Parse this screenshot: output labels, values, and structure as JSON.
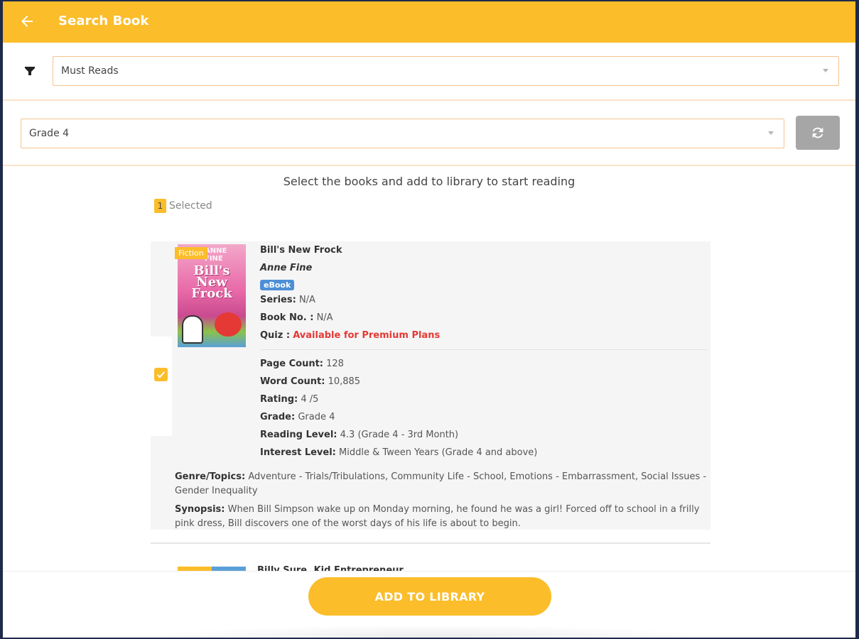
{
  "colors": {
    "accent": "#fbbd2a",
    "border": "#f7c38d",
    "premium": "#e53935",
    "ebook_badge": "#4d8fd6",
    "refresh_button": "#a6a6a6"
  },
  "header": {
    "title": "Search Book",
    "back_icon": "arrow-left-icon"
  },
  "filters": {
    "filter_icon": "funnel-icon",
    "category_value": "Must Reads",
    "grade_value": "Grade 4",
    "refresh_icon": "refresh-icon"
  },
  "instruction": "Select the books and add to library to start reading",
  "selection": {
    "count": "1",
    "label": "Selected"
  },
  "books": [
    {
      "title": "Bill's New Frock",
      "author": "Anne Fine",
      "tag": "Fiction",
      "format": "eBook",
      "checked": true,
      "series_label": "Series:",
      "series": "N/A",
      "book_no_label": "Book No. :",
      "book_no": "N/A",
      "quiz_label": "Quiz :",
      "quiz": "Available for Premium Plans",
      "page_count_label": "Page Count:",
      "page_count": "128",
      "word_count_label": "Word Count:",
      "word_count": "10,885",
      "rating_label": "Rating:",
      "rating": "4 /5",
      "grade_label": "Grade:",
      "grade": "Grade 4",
      "reading_level_label": "Reading Level:",
      "reading_level": "4.3 (Grade 4 - 3rd Month)",
      "interest_level_label": "Interest Level:",
      "interest_level": "Middle & Tween Years (Grade 4 and above)",
      "genre_label": "Genre/Topics:",
      "genre": "Adventure - Trials/Tribulations, Community Life - School, Emotions - Embarrassment, Social Issues - Gender Inequality",
      "synopsis_label": "Synopsis:",
      "synopsis": "When Bill Simpson wake up on Monday morning, he found he was a girl! Forced off to school in a frilly pink dress, Bill discovers one of the worst days of his life is about to begin."
    },
    {
      "title": "Billy Sure, Kid Entrepreneur"
    }
  ],
  "footer": {
    "add_button": "ADD TO LIBRARY"
  }
}
